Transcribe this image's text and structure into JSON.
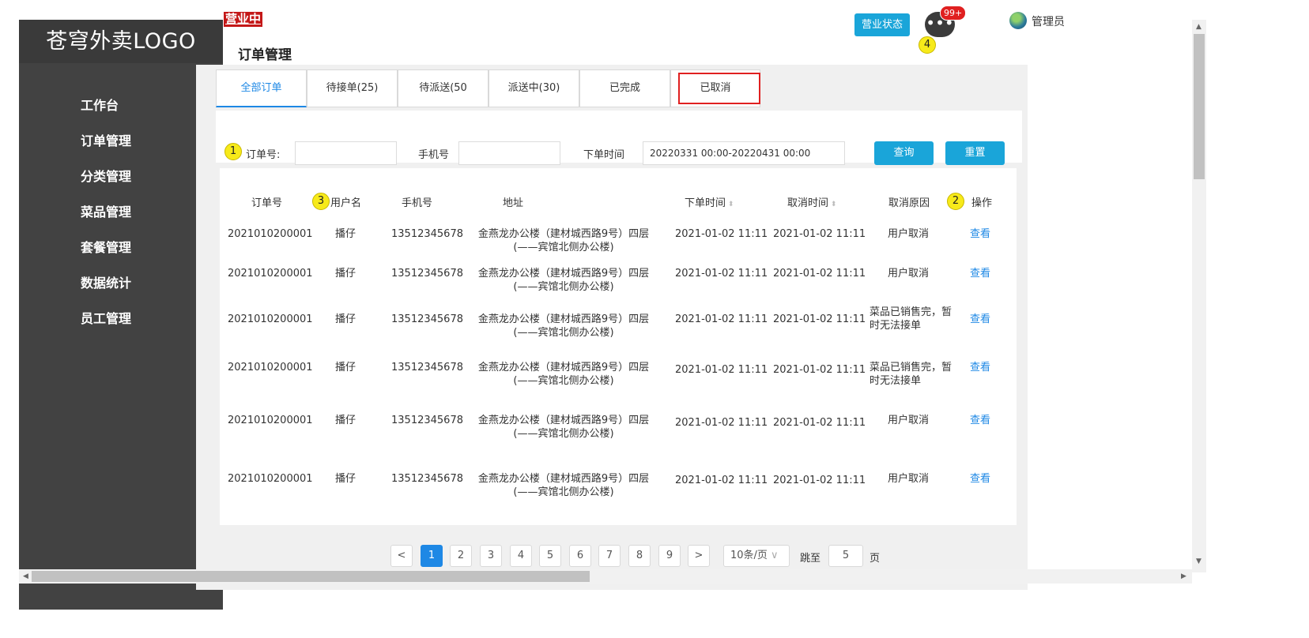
{
  "sidebar": {
    "logo": "苍穹外卖LOGO",
    "items": [
      "工作台",
      "订单管理",
      "分类管理",
      "菜品管理",
      "套餐管理",
      "数据统计",
      "员工管理"
    ]
  },
  "header": {
    "status": "营业中",
    "title": "订单管理",
    "business_status_btn": "营业状态",
    "message_badge": "99+",
    "user_name": "管理员"
  },
  "tabs": [
    "全部订单",
    "待接单(25)",
    "待派送(50",
    "派送中(30)",
    "已完成",
    "已取消"
  ],
  "filters": {
    "order_no_label": "订单号:",
    "order_no_value": "",
    "phone_label": "手机号",
    "phone_value": "",
    "time_label": "下单时间",
    "time_value": "20220331 00:00-20220431 00:00",
    "search_btn": "查询",
    "reset_btn": "重置"
  },
  "table": {
    "headers": [
      "订单号",
      "用户名",
      "手机号",
      "地址",
      "下单时间",
      "取消时间",
      "取消原因",
      "操作"
    ],
    "rows": [
      {
        "order_no": "2021010200001",
        "user": "播仔",
        "phone": "13512345678",
        "addr1": "金燕龙办公楼（建材城西路9号）四层",
        "addr2": "(——宾馆北侧办公楼)",
        "order_time": "2021-01-02 11:11",
        "cancel_time": "2021-01-02 11:11",
        "reason1": "用户取消",
        "reason2": "",
        "action": "查看"
      },
      {
        "order_no": "2021010200001",
        "user": "播仔",
        "phone": "13512345678",
        "addr1": "金燕龙办公楼（建材城西路9号）四层",
        "addr2": "(——宾馆北侧办公楼)",
        "order_time": "2021-01-02 11:11",
        "cancel_time": "2021-01-02 11:11",
        "reason1": "用户取消",
        "reason2": "",
        "action": "查看"
      },
      {
        "order_no": "2021010200001",
        "user": "播仔",
        "phone": "13512345678",
        "addr1": "金燕龙办公楼（建材城西路9号）四层",
        "addr2": "(——宾馆北侧办公楼)",
        "order_time": "2021-01-02 11:11",
        "cancel_time": "2021-01-02 11:11",
        "reason1": "菜品已销售完，暂",
        "reason2": "时无法接单",
        "action": "查看"
      },
      {
        "order_no": "2021010200001",
        "user": "播仔",
        "phone": "13512345678",
        "addr1": "金燕龙办公楼（建材城西路9号）四层",
        "addr2": "(——宾馆北侧办公楼)",
        "order_time": "2021-01-02 11:11",
        "cancel_time": "2021-01-02 11:11",
        "reason1": "菜品已销售完，暂",
        "reason2": "时无法接单",
        "action": "查看"
      },
      {
        "order_no": "2021010200001",
        "user": "播仔",
        "phone": "13512345678",
        "addr1": "金燕龙办公楼（建材城西路9号）四层",
        "addr2": "(——宾馆北侧办公楼)",
        "order_time": "2021-01-02 11:11",
        "cancel_time": "2021-01-02 11:11",
        "reason1": "用户取消",
        "reason2": "",
        "action": "查看"
      },
      {
        "order_no": "2021010200001",
        "user": "播仔",
        "phone": "13512345678",
        "addr1": "金燕龙办公楼（建材城西路9号）四层",
        "addr2": "(——宾馆北侧办公楼)",
        "order_time": "2021-01-02 11:11",
        "cancel_time": "2021-01-02 11:11",
        "reason1": "用户取消",
        "reason2": "",
        "action": "查看"
      }
    ]
  },
  "annotations": [
    "1",
    "2",
    "3",
    "4"
  ],
  "pagination": {
    "prev": "<",
    "pages": [
      "1",
      "2",
      "3",
      "4",
      "5",
      "6",
      "7",
      "8",
      "9"
    ],
    "current": "1",
    "next": ">",
    "page_size": "10条/页",
    "jump_label": "跳至",
    "jump_value": "5",
    "page_suffix": "页"
  },
  "colors": {
    "accent": "#1aa5d9",
    "sidebar": "#424242",
    "link": "#1e88e5",
    "danger": "#e02020"
  }
}
